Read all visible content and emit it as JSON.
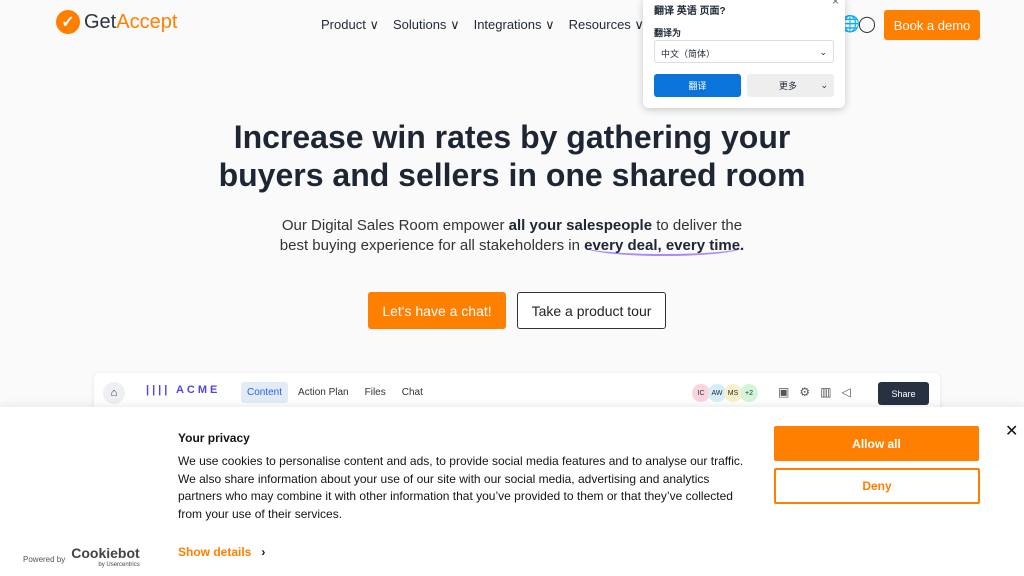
{
  "nav": {
    "logo_mark": "✓",
    "logo_get": "Get",
    "logo_accept": "Accept",
    "items": [
      "Product",
      "Solutions",
      "Integrations",
      "Resources"
    ],
    "chevron": "∨",
    "book": "Book a demo"
  },
  "translate": {
    "title": "翻译 英语 页面?",
    "close": "×",
    "label": "翻译为",
    "language": "中文（简体）",
    "translate_btn": "翻译",
    "more": "更多"
  },
  "hero": {
    "title_line1": "Increase win rates by gathering your",
    "title_line2": "buyers and sellers in one shared room",
    "sub1": "Our Digital Sales Room empower ",
    "sub1b": "all your salespeople",
    "sub1c": " to deliver the",
    "sub2": "best buying experience for all stakeholders in ",
    "sub2b": "every deal, every time.",
    "cta1": "Let's have a chat!",
    "cta2": "Take a product tour"
  },
  "app": {
    "brand": "ACME",
    "tabs": [
      "Content",
      "Action Plan",
      "Files",
      "Chat"
    ],
    "avatars": [
      {
        "t": "IC",
        "c": "#fbd5dc"
      },
      {
        "t": "AW",
        "c": "#d4eefa"
      },
      {
        "t": "MS",
        "c": "#fbefc9"
      },
      {
        "t": "+2",
        "c": "#d5f5d9"
      }
    ],
    "share": "Share"
  },
  "cookie": {
    "title": "Your privacy",
    "text": "We use cookies to personalise content and ads, to provide social media features and to analyse our traffic. We also share information about your use of our site with our social media, advertising and analytics partners who may combine it with other information that you’ve provided to them or that they’ve collected from your use of their services.",
    "powered": "Powered by",
    "brand": "Cookiebot",
    "brand_sub": "by Usercentrics",
    "details": "Show details",
    "allow": "Allow all",
    "deny": "Deny",
    "close": "✕"
  },
  "colors": {
    "accent": "#ff7f00",
    "translate": "#0a74da"
  }
}
